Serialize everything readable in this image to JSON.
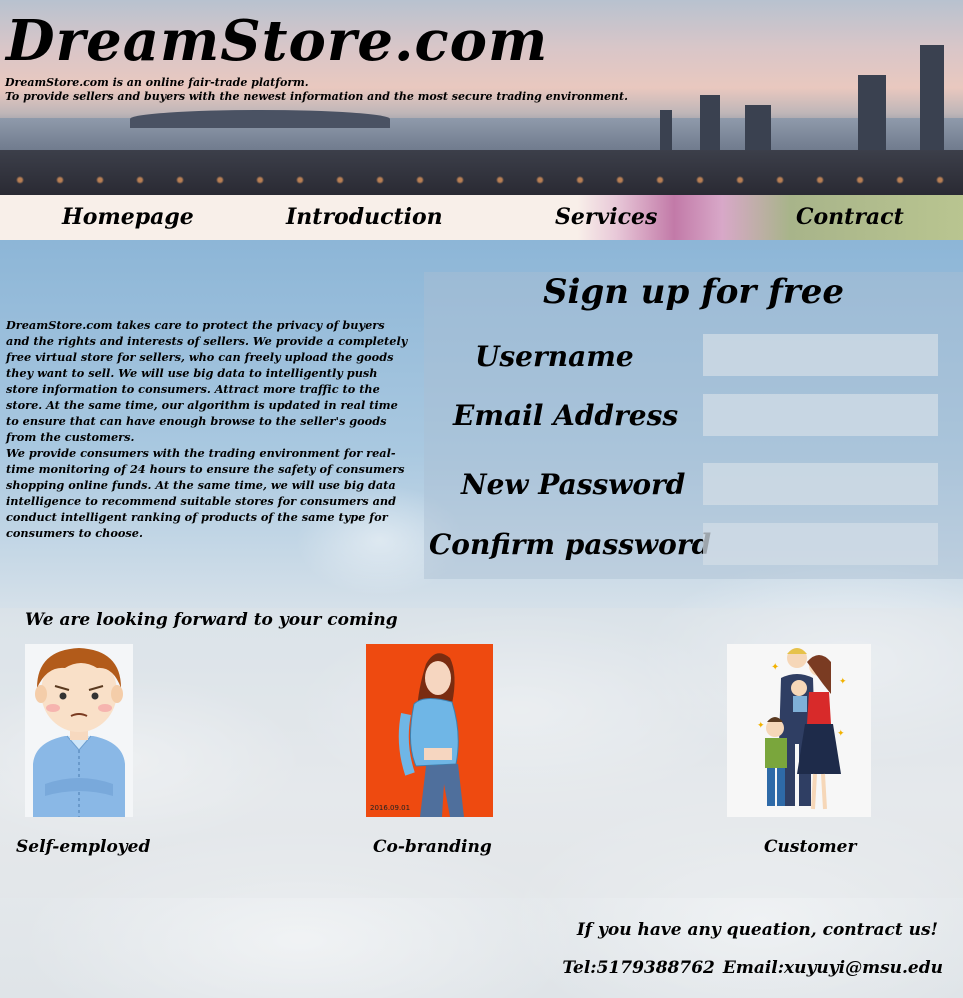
{
  "header": {
    "logo": "DreamStore.com",
    "tagline_line1": "DreamStore.com is an online fair-trade platform.",
    "tagline_line2": "To provide sellers and buyers with the newest information and the most secure trading environment."
  },
  "nav": {
    "items": [
      {
        "label": "Homepage"
      },
      {
        "label": "Introduction"
      },
      {
        "label": "Services"
      },
      {
        "label": "Contract"
      }
    ]
  },
  "about": {
    "paragraph1": "DreamStore.com takes care to protect the privacy of buyers and the rights and interests of sellers. We provide a completely free virtual store for sellers, who can freely upload the goods they want to sell. We will use big data to intelligently push store information to consumers. Attract more traffic to the store. At the same time, our algorithm is updated in real time to ensure that can have enough browse to the seller's goods from the customers.",
    "paragraph2": "We provide consumers with the trading environment for real-time monitoring of 24 hours to ensure the safety of consumers shopping online funds. At the same time, we will use big data intelligence to recommend suitable stores for consumers and conduct intelligent ranking of products of the same type for consumers to choose."
  },
  "signup": {
    "title": "Sign up for free",
    "fields": [
      {
        "label": "Username",
        "value": "",
        "placeholder": ""
      },
      {
        "label": "Email Address",
        "value": "",
        "placeholder": ""
      },
      {
        "label": "New Password",
        "value": "",
        "placeholder": ""
      },
      {
        "label": "Confirm password",
        "value": "",
        "placeholder": ""
      }
    ]
  },
  "community": {
    "heading": "We are looking forward to your coming",
    "cards": [
      {
        "label": "Self-employed"
      },
      {
        "label": "Co-branding"
      },
      {
        "label": "Customer"
      }
    ]
  },
  "footer": {
    "question": "If you have any queation, contract us!",
    "tel": "Tel:5179388762",
    "email": "Email:xuyuyi@msu.edu"
  }
}
